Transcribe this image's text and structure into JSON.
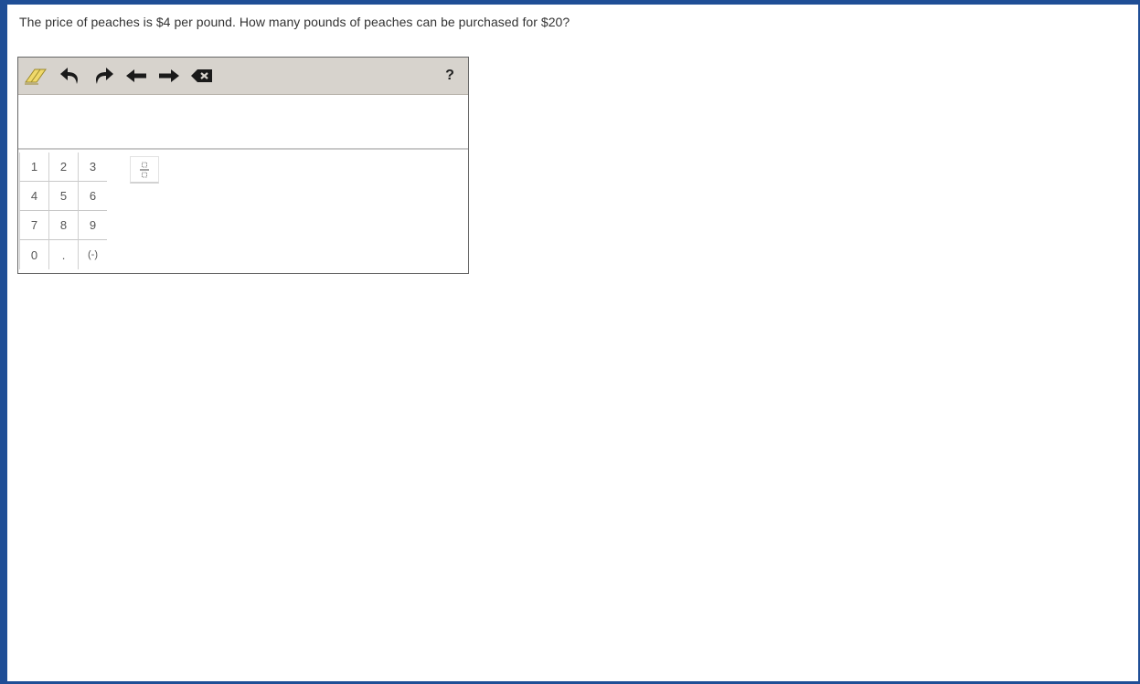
{
  "question": {
    "text": "The price of peaches is $4 per pound. How many pounds of peaches can be purchased for $20?"
  },
  "toolbar": {
    "tools": [
      "eraser-icon",
      "undo-icon",
      "redo-icon",
      "left-arrow-icon",
      "right-arrow-icon",
      "backspace-icon"
    ],
    "help_label": "?"
  },
  "answer": {
    "value": ""
  },
  "keypad": {
    "keys": [
      "1",
      "2",
      "3",
      "4",
      "5",
      "6",
      "7",
      "8",
      "9",
      "0",
      ".",
      "(-)"
    ],
    "fraction_icon": "fraction-icon"
  },
  "colors": {
    "frame_border": "#1f4e96",
    "toolbar_bg": "#d7d3cd",
    "eraser": "#f0d96a"
  }
}
